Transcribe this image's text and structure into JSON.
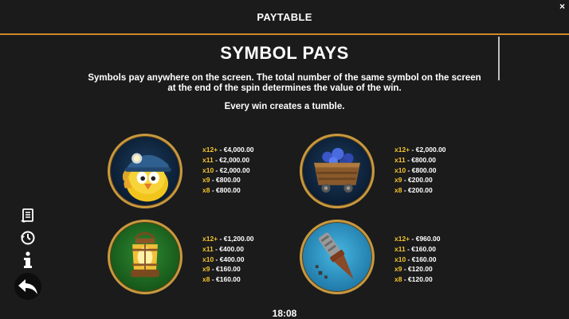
{
  "header": {
    "title": "PAYTABLE",
    "close_label": "×"
  },
  "section": {
    "title": "SYMBOL PAYS",
    "description": "Symbols pay anywhere on the screen. The total number of the same symbol on the screen at the end of the spin determines the value of the win.",
    "tumble_note": "Every win creates a tumble."
  },
  "symbols": [
    {
      "name": "miner-chick",
      "pays": [
        {
          "count": "x12+",
          "value": "€4,000.00"
        },
        {
          "count": "x11",
          "value": "€2,000.00"
        },
        {
          "count": "x10",
          "value": "€2,000.00"
        },
        {
          "count": "x9",
          "value": "€800.00"
        },
        {
          "count": "x8",
          "value": "€800.00"
        }
      ]
    },
    {
      "name": "mine-cart",
      "pays": [
        {
          "count": "x12+",
          "value": "€2,000.00"
        },
        {
          "count": "x11",
          "value": "€800.00"
        },
        {
          "count": "x10",
          "value": "€800.00"
        },
        {
          "count": "x9",
          "value": "€200.00"
        },
        {
          "count": "x8",
          "value": "€200.00"
        }
      ]
    },
    {
      "name": "lantern",
      "pays": [
        {
          "count": "x12+",
          "value": "€1,200.00"
        },
        {
          "count": "x11",
          "value": "€400.00"
        },
        {
          "count": "x10",
          "value": "€400.00"
        },
        {
          "count": "x9",
          "value": "€160.00"
        },
        {
          "count": "x8",
          "value": "€160.00"
        }
      ]
    },
    {
      "name": "drill",
      "pays": [
        {
          "count": "x12+",
          "value": "€960.00"
        },
        {
          "count": "x11",
          "value": "€160.00"
        },
        {
          "count": "x10",
          "value": "€160.00"
        },
        {
          "count": "x9",
          "value": "€120.00"
        },
        {
          "count": "x8",
          "value": "€120.00"
        }
      ]
    }
  ],
  "sidebar": [
    "rules-scroll-icon",
    "history-icon",
    "info-icon",
    "back-arrow-icon"
  ],
  "footer": {
    "clock": "18:08"
  },
  "colors": {
    "accent": "#d08a2a",
    "multiplier": "#f4c430",
    "background": "#1b1b1b"
  }
}
